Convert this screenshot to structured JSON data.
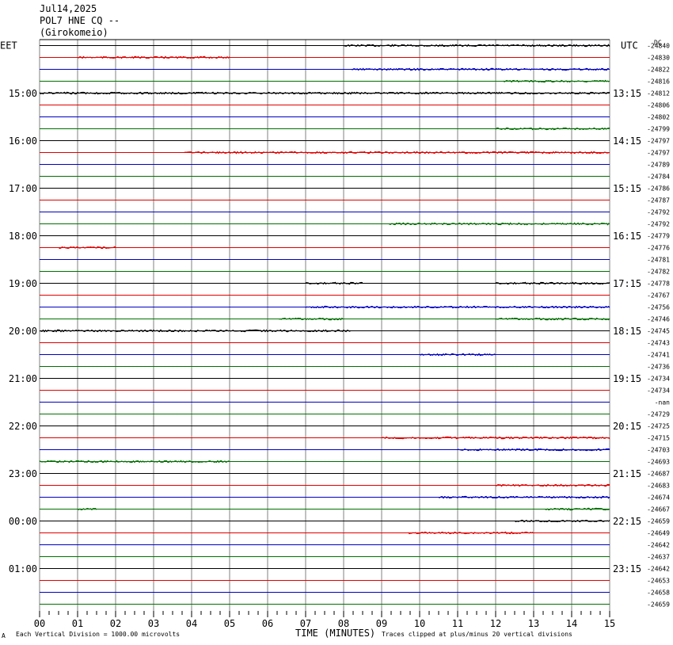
{
  "header": {
    "date": "Jul14,2025",
    "station": "POL7 HNE CQ --",
    "location": "(Girokomeio)"
  },
  "left_axis_label": "EET",
  "right_axis_label": "UTC",
  "dc_label": "DC",
  "footer": {
    "scale_note": "Each Vertical Division = 1000.00 microvolts",
    "x_title": "TIME (MINUTES)",
    "clip_note": "Traces clipped at plus/minus 20 vertical divisions",
    "corner_mark": "A"
  },
  "colors": {
    "black": "#000000",
    "red": "#e00000",
    "blue": "#0000c0",
    "green": "#007000",
    "grid": "#808080"
  },
  "chart_data": {
    "type": "line",
    "xlabel": "TIME (MINUTES)",
    "xlim": [
      0,
      15
    ],
    "x_ticks": [
      "00",
      "01",
      "02",
      "03",
      "04",
      "05",
      "06",
      "07",
      "08",
      "09",
      "10",
      "11",
      "12",
      "13",
      "14",
      "15"
    ],
    "trace_color_cycle": [
      "black",
      "red",
      "blue",
      "green"
    ],
    "left_hour_labels": [
      {
        "row": 4,
        "label": "15:00"
      },
      {
        "row": 8,
        "label": "16:00"
      },
      {
        "row": 12,
        "label": "17:00"
      },
      {
        "row": 16,
        "label": "18:00"
      },
      {
        "row": 20,
        "label": "19:00"
      },
      {
        "row": 24,
        "label": "20:00"
      },
      {
        "row": 28,
        "label": "21:00"
      },
      {
        "row": 32,
        "label": "22:00"
      },
      {
        "row": 36,
        "label": "23:00"
      },
      {
        "row": 40,
        "label": "00:00"
      },
      {
        "row": 44,
        "label": "01:00"
      }
    ],
    "right_hour_labels": [
      {
        "row": 4,
        "label": "13:15"
      },
      {
        "row": 8,
        "label": "14:15"
      },
      {
        "row": 12,
        "label": "15:15"
      },
      {
        "row": 16,
        "label": "16:15"
      },
      {
        "row": 20,
        "label": "17:15"
      },
      {
        "row": 24,
        "label": "18:15"
      },
      {
        "row": 28,
        "label": "19:15"
      },
      {
        "row": 32,
        "label": "20:15"
      },
      {
        "row": 36,
        "label": "21:15"
      },
      {
        "row": 40,
        "label": "22:15"
      },
      {
        "row": 44,
        "label": "23:15"
      }
    ],
    "dc_offsets": [
      "-24840",
      "-24830",
      "-24822",
      "-24816",
      "-24812",
      "-24806",
      "-24802",
      "-24799",
      "-24797",
      "-24797",
      "-24789",
      "-24784",
      "-24786",
      "-24787",
      "-24792",
      "-24792",
      "-24779",
      "-24776",
      "-24781",
      "-24782",
      "-24778",
      "-24767",
      "-24756",
      "-24746",
      "-24745",
      "-24743",
      "-24741",
      "-24736",
      "-24734",
      "-24734",
      "-nan",
      "-24729",
      "-24725",
      "-24715",
      "-24703",
      "-24693",
      "-24687",
      "-24683",
      "-24674",
      "-24667",
      "-24659",
      "-24649",
      "-24642",
      "-24637",
      "-24642",
      "-24653",
      "-24658",
      "-24659"
    ],
    "activity": [
      {
        "row": 0,
        "segments": [
          [
            8,
            15
          ]
        ]
      },
      {
        "row": 1,
        "segments": [
          [
            1,
            5
          ]
        ]
      },
      {
        "row": 2,
        "segments": [
          [
            8.2,
            15
          ]
        ]
      },
      {
        "row": 3,
        "segments": [
          [
            12.2,
            15
          ]
        ]
      },
      {
        "row": 4,
        "segments": [
          [
            0,
            15
          ]
        ]
      },
      {
        "row": 7,
        "segments": [
          [
            12,
            15
          ]
        ]
      },
      {
        "row": 9,
        "segments": [
          [
            3.8,
            15
          ]
        ]
      },
      {
        "row": 15,
        "segments": [
          [
            9.2,
            15
          ]
        ]
      },
      {
        "row": 17,
        "segments": [
          [
            0.5,
            2
          ]
        ]
      },
      {
        "row": 20,
        "segments": [
          [
            7,
            8.5
          ],
          [
            12,
            15
          ]
        ]
      },
      {
        "row": 22,
        "segments": [
          [
            7,
            15
          ]
        ]
      },
      {
        "row": 23,
        "segments": [
          [
            6.3,
            8
          ],
          [
            12,
            15
          ]
        ]
      },
      {
        "row": 24,
        "segments": [
          [
            0,
            8.2
          ]
        ]
      },
      {
        "row": 26,
        "segments": [
          [
            10,
            12
          ]
        ]
      },
      {
        "row": 33,
        "segments": [
          [
            9,
            15
          ]
        ]
      },
      {
        "row": 34,
        "segments": [
          [
            11,
            15
          ]
        ]
      },
      {
        "row": 35,
        "segments": [
          [
            0,
            5
          ]
        ]
      },
      {
        "row": 37,
        "segments": [
          [
            12,
            15
          ]
        ]
      },
      {
        "row": 38,
        "segments": [
          [
            10.5,
            15
          ]
        ]
      },
      {
        "row": 39,
        "segments": [
          [
            1,
            1.5
          ],
          [
            13.3,
            15
          ]
        ]
      },
      {
        "row": 40,
        "segments": [
          [
            12.5,
            15
          ]
        ]
      },
      {
        "row": 41,
        "segments": [
          [
            9.7,
            13
          ]
        ]
      }
    ]
  }
}
